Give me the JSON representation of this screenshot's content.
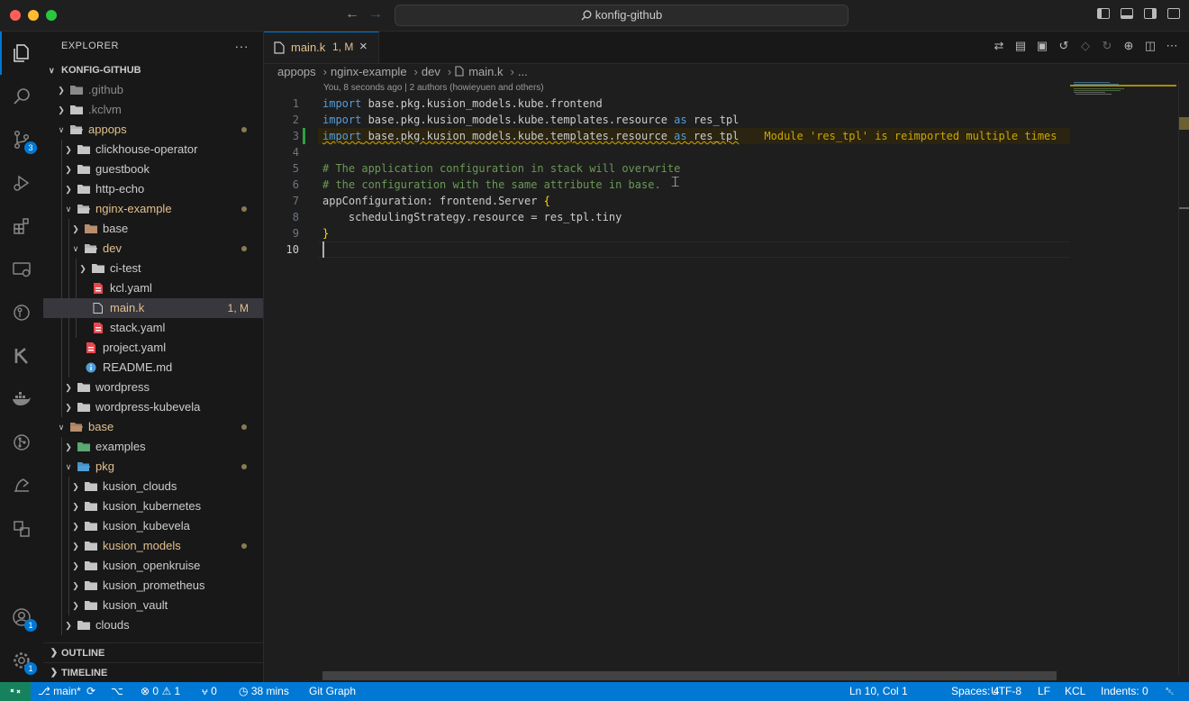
{
  "window": {
    "title": "konfig-github"
  },
  "activity_bar": {
    "items": [
      {
        "name": "explorer",
        "badge": ""
      },
      {
        "name": "search",
        "badge": ""
      },
      {
        "name": "source-control",
        "badge": "3"
      },
      {
        "name": "run-debug",
        "badge": ""
      },
      {
        "name": "extensions",
        "badge": ""
      },
      {
        "name": "remote-explorer",
        "badge": ""
      },
      {
        "name": "gitlens",
        "badge": ""
      },
      {
        "name": "kcl",
        "badge": ""
      },
      {
        "name": "docker",
        "badge": ""
      },
      {
        "name": "git-graph",
        "badge": ""
      },
      {
        "name": "timeline",
        "badge": ""
      },
      {
        "name": "containers",
        "badge": ""
      }
    ],
    "accounts_badge": "1",
    "settings_badge": "1"
  },
  "explorer": {
    "header": "EXPLORER",
    "more": "···",
    "root": "KONFIG-GITHUB",
    "tree": [
      {
        "label": ".github",
        "depth": 1,
        "type": "folder-github",
        "open": false,
        "status": "dim"
      },
      {
        "label": ".kclvm",
        "depth": 1,
        "type": "folder",
        "open": false,
        "status": "dim"
      },
      {
        "label": "appops",
        "depth": 1,
        "type": "folder",
        "open": true,
        "status": "mod",
        "dot": true
      },
      {
        "label": "clickhouse-operator",
        "depth": 2,
        "type": "folder",
        "open": false
      },
      {
        "label": "guestbook",
        "depth": 2,
        "type": "folder",
        "open": false
      },
      {
        "label": "http-echo",
        "depth": 2,
        "type": "folder",
        "open": false
      },
      {
        "label": "nginx-example",
        "depth": 2,
        "type": "folder",
        "open": true,
        "status": "mod",
        "dot": true
      },
      {
        "label": "base",
        "depth": 3,
        "type": "folder-base",
        "open": false
      },
      {
        "label": "dev",
        "depth": 3,
        "type": "folder",
        "open": true,
        "status": "mod",
        "dot": true
      },
      {
        "label": "ci-test",
        "depth": 4,
        "type": "folder",
        "open": false
      },
      {
        "label": "kcl.yaml",
        "depth": 4,
        "type": "yaml"
      },
      {
        "label": "main.k",
        "depth": 4,
        "type": "file",
        "status": "mod",
        "selected": true,
        "badge": "1, M"
      },
      {
        "label": "stack.yaml",
        "depth": 4,
        "type": "yaml"
      },
      {
        "label": "project.yaml",
        "depth": 3,
        "type": "yaml"
      },
      {
        "label": "README.md",
        "depth": 3,
        "type": "info"
      },
      {
        "label": "wordpress",
        "depth": 2,
        "type": "folder",
        "open": false
      },
      {
        "label": "wordpress-kubevela",
        "depth": 2,
        "type": "folder",
        "open": false
      },
      {
        "label": "base",
        "depth": 1,
        "type": "folder-base",
        "open": true,
        "status": "mod",
        "dot": true
      },
      {
        "label": "examples",
        "depth": 2,
        "type": "folder-examples",
        "open": false
      },
      {
        "label": "pkg",
        "depth": 2,
        "type": "folder-pkg",
        "open": true,
        "status": "mod",
        "dot": true
      },
      {
        "label": "kusion_clouds",
        "depth": 3,
        "type": "folder",
        "open": false
      },
      {
        "label": "kusion_kubernetes",
        "depth": 3,
        "type": "folder",
        "open": false
      },
      {
        "label": "kusion_kubevela",
        "depth": 3,
        "type": "folder",
        "open": false
      },
      {
        "label": "kusion_models",
        "depth": 3,
        "type": "folder",
        "open": false,
        "status": "mod",
        "dot": true
      },
      {
        "label": "kusion_openkruise",
        "depth": 3,
        "type": "folder",
        "open": false
      },
      {
        "label": "kusion_prometheus",
        "depth": 3,
        "type": "folder",
        "open": false
      },
      {
        "label": "kusion_vault",
        "depth": 3,
        "type": "folder",
        "open": false
      },
      {
        "label": "clouds",
        "depth": 2,
        "type": "folder",
        "open": false
      }
    ],
    "sections": [
      "OUTLINE",
      "TIMELINE"
    ]
  },
  "tab": {
    "name": "main.k",
    "badge": "1, M",
    "close": "×"
  },
  "breadcrumb": [
    "appops",
    "nginx-example",
    "dev",
    "main.k",
    "..."
  ],
  "blame": "You, 8 seconds ago | 2 authors (howieyuen and others)",
  "code": {
    "line_numbers": [
      "1",
      "2",
      "3",
      "4",
      "5",
      "6",
      "7",
      "8",
      "9",
      "10"
    ],
    "l1_kw": "import",
    "l1_rest": " base.pkg.kusion_models.kube.frontend",
    "l2_kw": "import",
    "l2_mid": " base.pkg.kusion_models.kube.templates.resource ",
    "l2_as": "as",
    "l2_end": " res_tpl",
    "l3_kw": "import",
    "l3_mid": " base.pkg.kusion_models.kube.templates.resource ",
    "l3_as": "as",
    "l3_end": " res_tpl",
    "l3_diag": "Module 'res_tpl' is reimported multiple times",
    "l5": "# The application configuration in stack will overwrite",
    "l6": "# the configuration with the same attribute in base.",
    "l7": "appConfiguration: frontend.Server ",
    "l7_brace": "{",
    "l8": "    schedulingStrategy.resource = res_tpl.tiny",
    "l9": "}"
  },
  "status": {
    "branch": "main*",
    "errors": "0",
    "warnings": "1",
    "ports": "0",
    "time": "38 mins",
    "git_graph": "Git Graph",
    "position": "Ln 10, Col 1",
    "spaces": "Spaces: 4",
    "encoding": "UTF-8",
    "eol": "LF",
    "language": "KCL",
    "indents": "Indents: 0"
  },
  "colors": {
    "accent": "#0078d4",
    "modified": "#e2c08d",
    "warning": "#cca700"
  }
}
